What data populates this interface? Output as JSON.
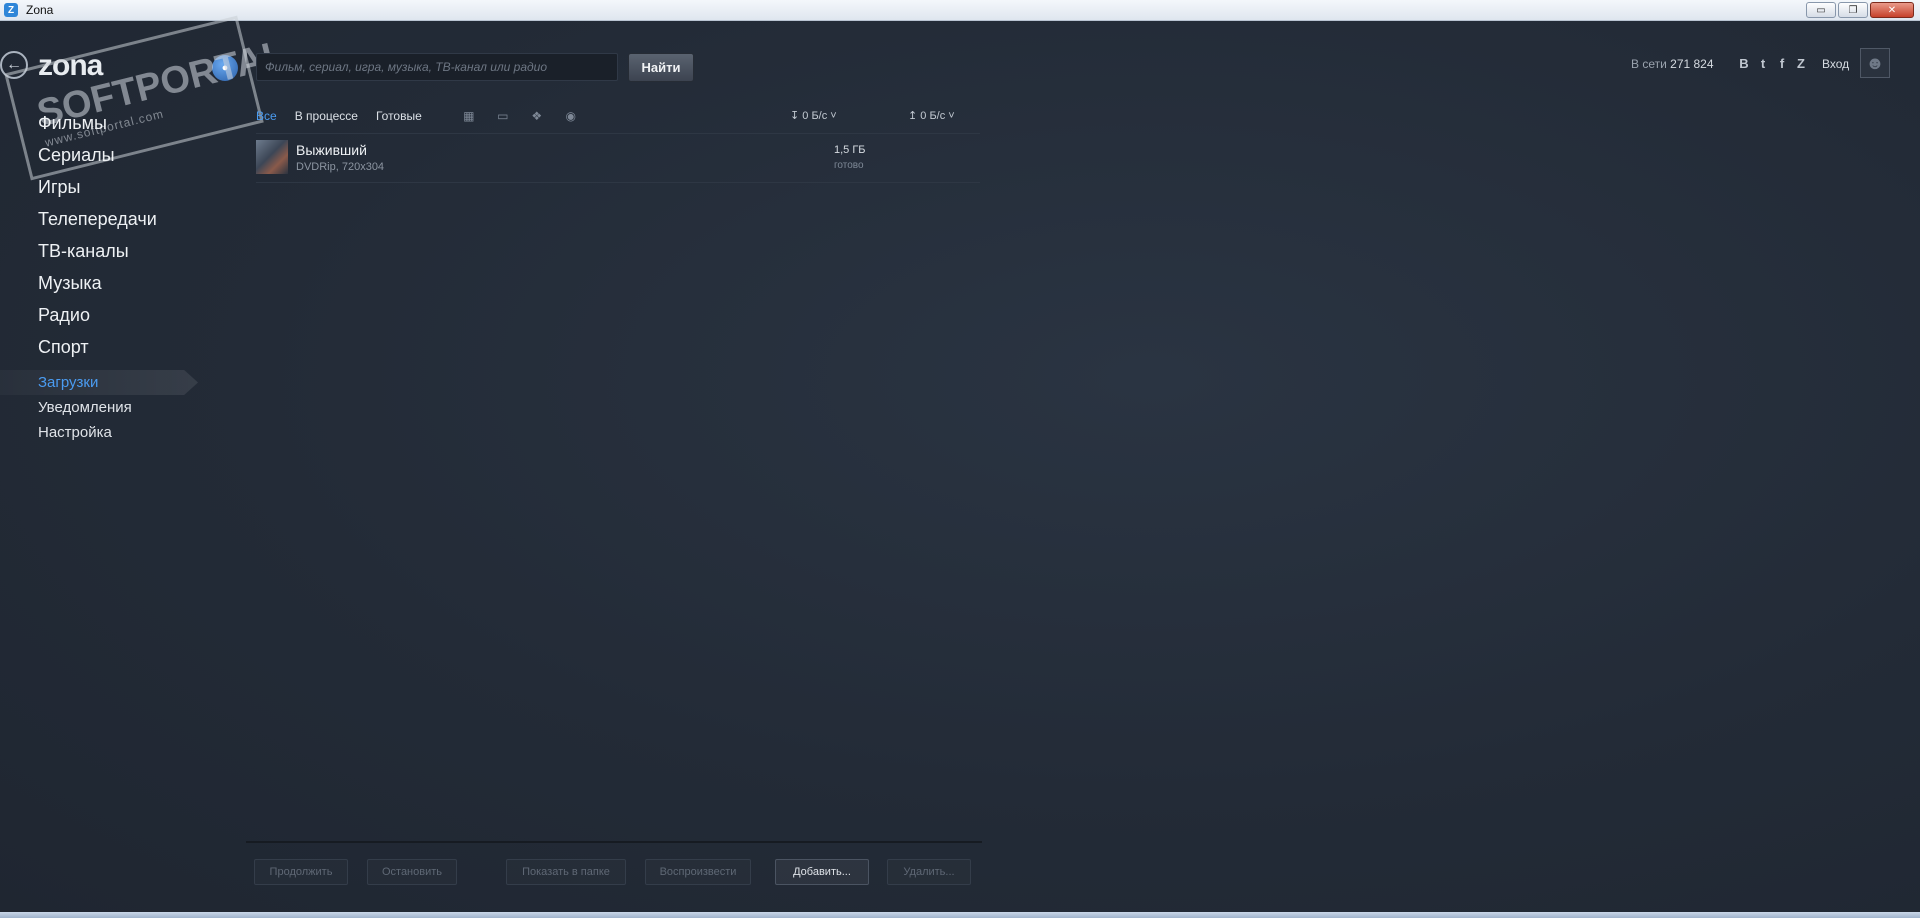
{
  "window": {
    "title": "Zona",
    "minimize_label": "▭",
    "maximize_label": "❐",
    "close_label": "✕"
  },
  "header": {
    "logo": "zona",
    "watermark": "SOFTPORTAL",
    "watermark_url": "www.softportal.com",
    "search_placeholder": "Фильм, сериал, игра, музыка, ТВ-канал или радио",
    "search_button": "Найти",
    "online_label": "В сети",
    "online_count": "271 824",
    "socials": [
      "В",
      "t",
      "f",
      "Z"
    ],
    "login_label": "Вход"
  },
  "sidebar": {
    "main_items": [
      "Фильмы",
      "Сериалы",
      "Игры",
      "Телепередачи",
      "ТВ-каналы",
      "Музыка",
      "Радио",
      "Спорт"
    ],
    "secondary_items": [
      {
        "label": "Загрузки",
        "active": true
      },
      {
        "label": "Уведомления",
        "active": false
      },
      {
        "label": "Настройка",
        "active": false
      }
    ]
  },
  "downloads": {
    "tabs": [
      "Все",
      "В процессе",
      "Готовые"
    ],
    "active_tab": "Все",
    "type_filters": [
      "film-icon",
      "tv-icon",
      "gamepad-icon",
      "headphones-icon"
    ],
    "download_speed": "0 Б/с",
    "upload_speed": "0 Б/с",
    "items": [
      {
        "title": "Выживший",
        "subtitle": "DVDRip, 720x304",
        "size": "1,5 ГБ",
        "status": "готово"
      }
    ]
  },
  "actions": {
    "resume": "Продолжить",
    "stop": "Остановить",
    "show_in_folder": "Показать в папке",
    "play": "Воспроизвести",
    "add": "Добавить...",
    "delete": "Удалить..."
  },
  "colors": {
    "background": "#222a36",
    "accent": "#4a9bf0"
  }
}
